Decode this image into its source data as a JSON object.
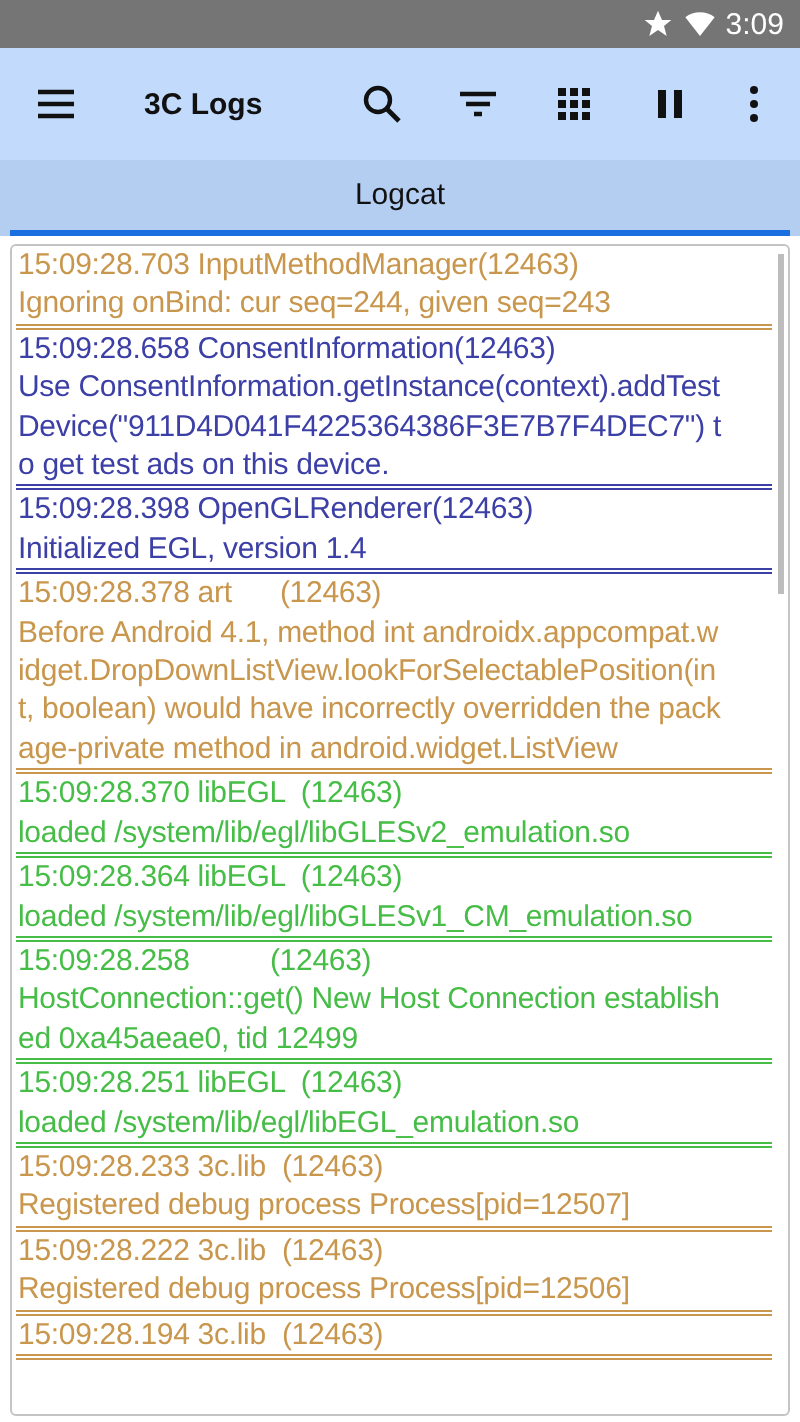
{
  "status_bar": {
    "time": "3:09"
  },
  "app_bar": {
    "title": "3C Logs"
  },
  "tabs": [
    {
      "label": "Logcat",
      "selected": true
    }
  ],
  "logs": [
    {
      "header": "15:09:28.703 InputMethodManager(12463)",
      "lines": [
        "Ignoring onBind: cur seq=244, given seq=243"
      ],
      "color": "#c8964c"
    },
    {
      "header": "15:09:28.658 ConsentInformation(12463)",
      "lines": [
        "Use ConsentInformation.getInstance(context).addTest",
        "Device(\"911D4D041F4225364386F3E7B7F4DEC7\") t",
        "o get test ads on this device."
      ],
      "color": "#3b3fa6"
    },
    {
      "header": "15:09:28.398 OpenGLRenderer(12463)",
      "lines": [
        "Initialized EGL, version 1.4"
      ],
      "color": "#3b3fa6"
    },
    {
      "header": "15:09:28.378 art      (12463)",
      "lines": [
        "Before Android 4.1, method int androidx.appcompat.w",
        "idget.DropDownListView.lookForSelectablePosition(in",
        "t, boolean) would have incorrectly overridden the pack",
        "age-private method in android.widget.ListView"
      ],
      "color": "#c8964c"
    },
    {
      "header": "15:09:28.370 libEGL  (12463)",
      "lines": [
        "loaded /system/lib/egl/libGLESv2_emulation.so"
      ],
      "color": "#46bd46"
    },
    {
      "header": "15:09:28.364 libEGL  (12463)",
      "lines": [
        "loaded /system/lib/egl/libGLESv1_CM_emulation.so"
      ],
      "color": "#46bd46"
    },
    {
      "header": "15:09:28.258          (12463)",
      "lines": [
        "HostConnection::get() New Host Connection establish",
        "ed 0xa45aeae0, tid 12499"
      ],
      "color": "#46bd46"
    },
    {
      "header": "15:09:28.251 libEGL  (12463)",
      "lines": [
        "loaded /system/lib/egl/libEGL_emulation.so"
      ],
      "color": "#46bd46"
    },
    {
      "header": "15:09:28.233 3c.lib  (12463)",
      "lines": [
        "Registered debug process Process[pid=12507]"
      ],
      "color": "#c8964c"
    },
    {
      "header": "15:09:28.222 3c.lib  (12463)",
      "lines": [
        "Registered debug process Process[pid=12506]"
      ],
      "color": "#c8964c"
    },
    {
      "header": "15:09:28.194 3c.lib  (12463)",
      "color": "#c8964c"
    }
  ]
}
